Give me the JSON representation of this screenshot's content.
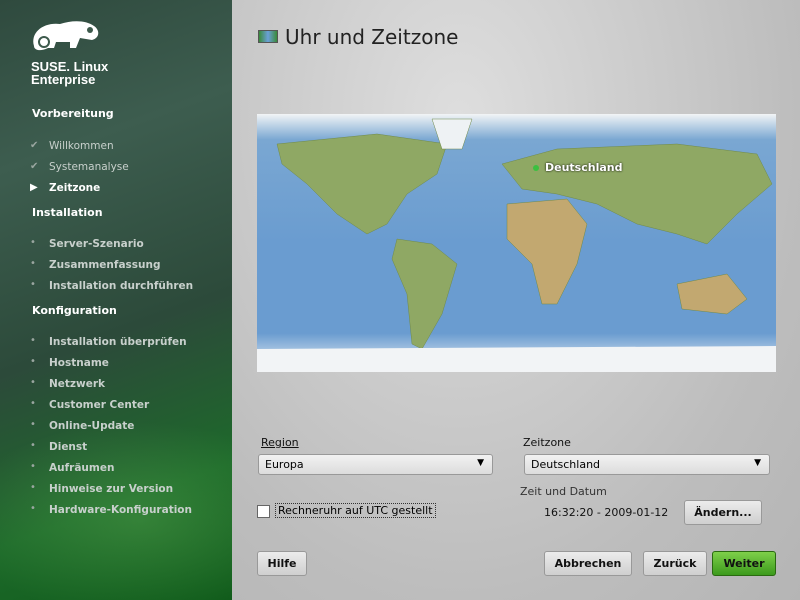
{
  "brand": {
    "line1": "SUSE. Linux",
    "line2": "Enterprise"
  },
  "sidebar": {
    "sections": [
      {
        "label": "Vorbereitung",
        "items": [
          {
            "label": "Willkommen",
            "state": "done"
          },
          {
            "label": "Systemanalyse",
            "state": "done"
          },
          {
            "label": "Zeitzone",
            "state": "current"
          }
        ]
      },
      {
        "label": "Installation",
        "items": [
          {
            "label": "Server-Szenario"
          },
          {
            "label": "Zusammenfassung"
          },
          {
            "label": "Installation durchführen"
          }
        ]
      },
      {
        "label": "Konfiguration",
        "items": [
          {
            "label": "Installation überprüfen"
          },
          {
            "label": "Hostname"
          },
          {
            "label": "Netzwerk"
          },
          {
            "label": "Customer Center"
          },
          {
            "label": "Online-Update"
          },
          {
            "label": "Dienst"
          },
          {
            "label": "Aufräumen"
          },
          {
            "label": "Hinweise zur Version"
          },
          {
            "label": "Hardware-Konfiguration"
          }
        ]
      }
    ]
  },
  "main": {
    "title": "Uhr und Zeitzone",
    "map_label": "Deutschland",
    "region_label": "Region",
    "region_value": "Europa",
    "zone_label": "Zeitzone",
    "zone_value": "Deutschland",
    "datetime_label": "Zeit und Datum",
    "datetime_value": "16:32:20 - 2009-01-12",
    "utc_label": "Rechneruhr auf UTC gestellt",
    "utc_checked": false,
    "change_button": "Ändern..."
  },
  "buttons": {
    "help": "Hilfe",
    "cancel": "Abbrechen",
    "back": "Zurück",
    "next": "Weiter"
  },
  "colors": {
    "accent": "#5ab52e"
  }
}
